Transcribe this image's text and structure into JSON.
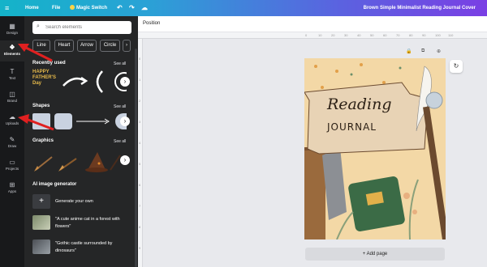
{
  "topbar": {
    "menu_icon": "≡",
    "home": "Home",
    "file": "File",
    "magic_switch": "Magic Switch",
    "undo_icon": "↶",
    "redo_icon": "↷",
    "cloud_icon": "☁",
    "doc_title": "Brown Simple Minimalist Reading Journal Cover"
  },
  "rail": {
    "items": [
      {
        "icon": "▦",
        "label": "Design"
      },
      {
        "icon": "❖",
        "label": "Elements"
      },
      {
        "icon": "T",
        "label": "Text"
      },
      {
        "icon": "◫",
        "label": "Brand"
      },
      {
        "icon": "☁",
        "label": "Uploads"
      },
      {
        "icon": "✎",
        "label": "Draw"
      },
      {
        "icon": "▭",
        "label": "Projects"
      },
      {
        "icon": "⊞",
        "label": "Apps"
      }
    ]
  },
  "panel": {
    "search_placeholder": "Search elements",
    "chips": [
      "Line",
      "Heart",
      "Arrow",
      "Circle"
    ],
    "chip_next": "›",
    "recently_used": "Recently used",
    "shapes": "Shapes",
    "graphics": "Graphics",
    "see_all": "See all",
    "ai_title": "AI image generator",
    "ai_items": [
      {
        "icon": "+",
        "text": "Generate your own"
      },
      {
        "icon": "",
        "text": "\"A cute anime cat in a forest with flowers\""
      },
      {
        "icon": "",
        "text": "\"Gothic castle surrounded by dinosaurs\""
      }
    ],
    "recent_thumb_text": "HAPPY FATHER'S Day",
    "search_icon": "search-icon"
  },
  "canvas": {
    "toolbar_label": "Position",
    "add_page": "+ Add page",
    "refresh_icon": "↻",
    "ruler_h": [
      "0",
      "10",
      "20",
      "30",
      "40",
      "50",
      "60",
      "70",
      "80",
      "90",
      "100",
      "110",
      "120",
      "130",
      "140",
      "150",
      "160",
      "170",
      "180"
    ],
    "ruler_v": [
      "0",
      "1",
      "2",
      "3",
      "4",
      "5",
      "6",
      "7",
      "8",
      "9",
      "10"
    ]
  },
  "design": {
    "title_script": "Reading",
    "title_caps": "JOURNAL"
  },
  "colors": {
    "arrow": "#e02020",
    "panel": "#252627",
    "page_bg": "#f3d8a6"
  }
}
